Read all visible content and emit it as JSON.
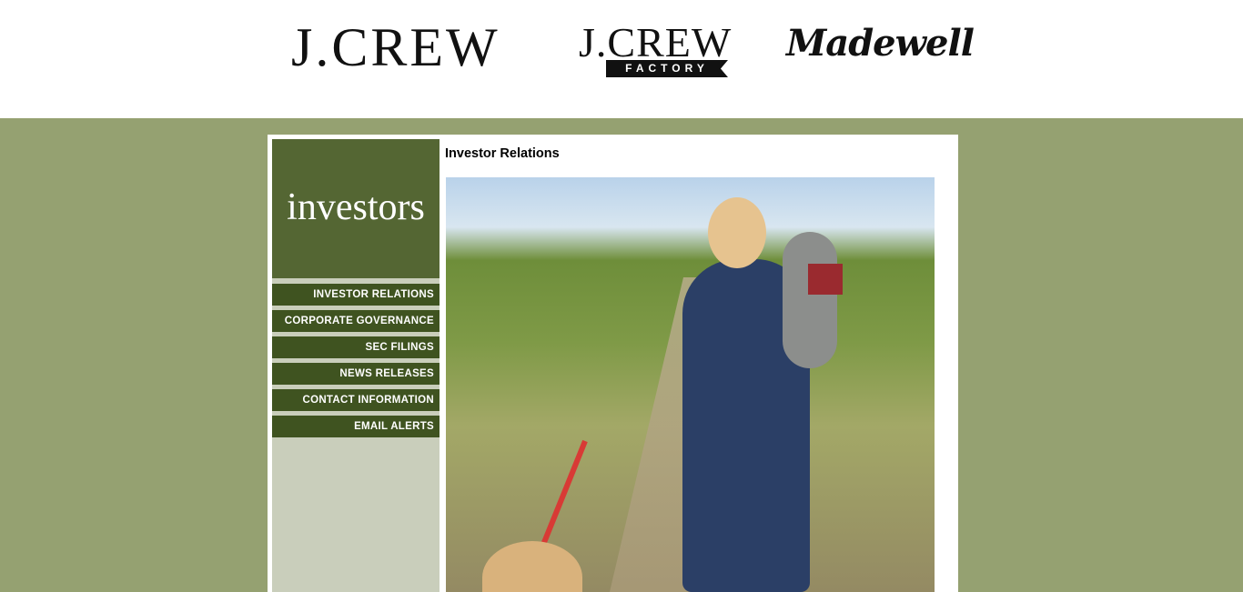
{
  "header": {
    "logos": {
      "jcrew": "J.CREW",
      "jcrew_factory": {
        "word": "J.CREW",
        "tag": "FACTORY"
      },
      "madewell": "Madewell"
    }
  },
  "sidebar": {
    "brand": "investors",
    "nav": [
      "INVESTOR RELATIONS",
      "CORPORATE GOVERNANCE",
      "SEC FILINGS",
      "NEWS RELEASES",
      "CONTACT INFORMATION",
      "EMAIL ALERTS"
    ]
  },
  "main": {
    "title": "Investor Relations"
  },
  "colors": {
    "page_bg": "#95a171",
    "brand_green": "#546633",
    "nav_green": "#3f5320",
    "sidebar_fill": "#c9cebb"
  }
}
